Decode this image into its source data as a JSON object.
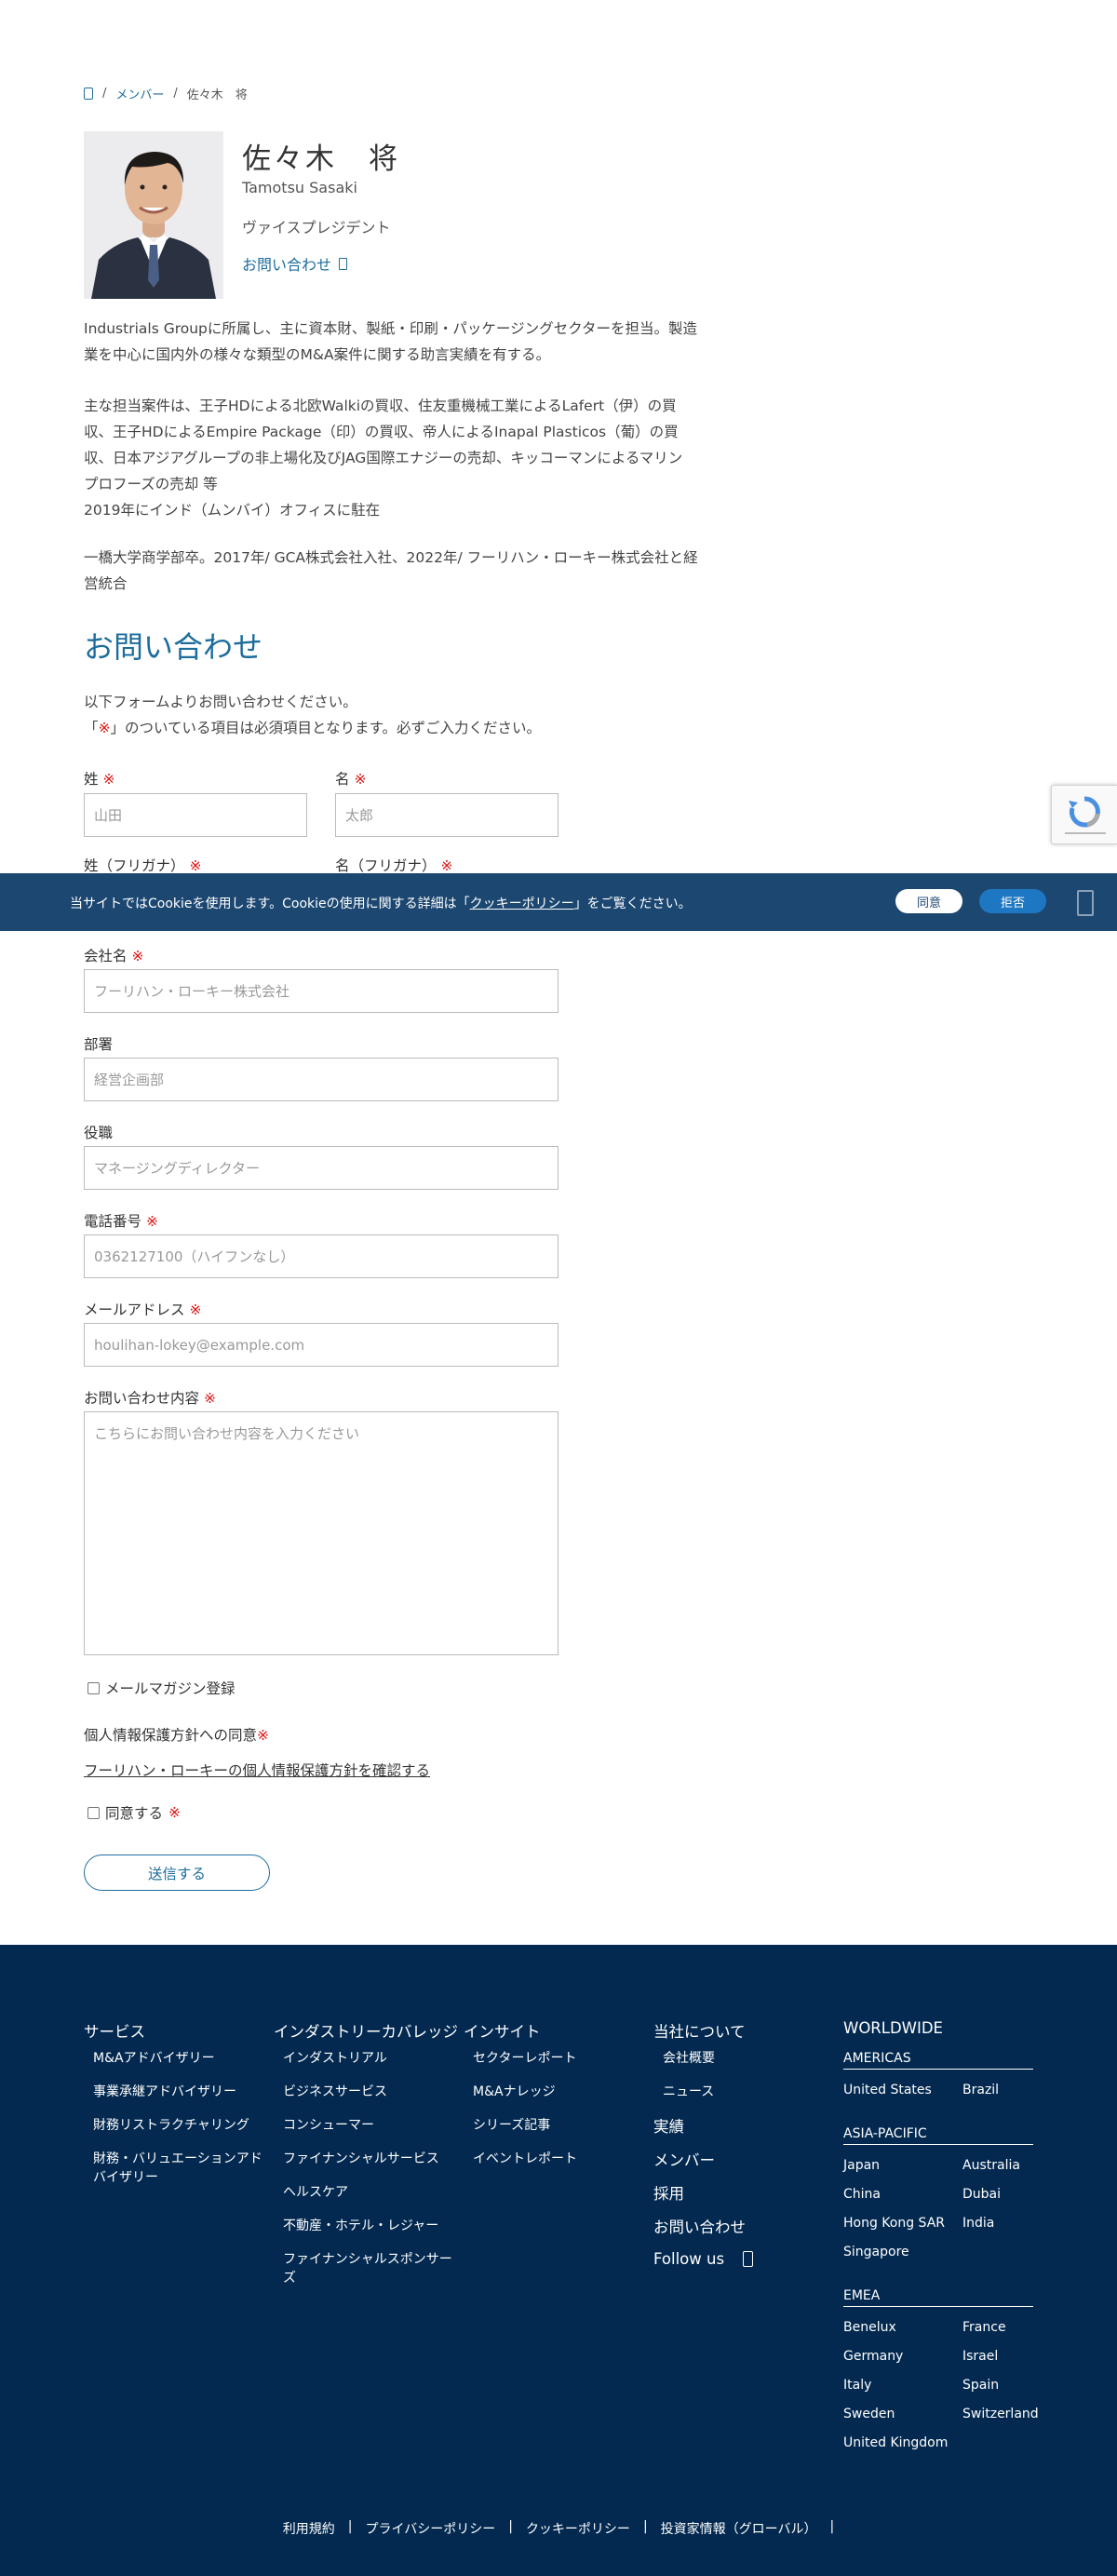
{
  "breadcrumb": {
    "members": "メンバー",
    "current": "佐々木　将"
  },
  "profile": {
    "name_jp": "佐々木　将",
    "name_en": "Tamotsu Sasaki",
    "title": "ヴァイスプレジデント",
    "contact_link": "お問い合わせ"
  },
  "bio": {
    "p1": "Industrials Groupに所属し、主に資本財、製紙・印刷・パッケージングセクターを担当。製造\n業を中心に国内外の様々な類型のM&A案件に関する助言実績を有する。",
    "p2": "主な担当案件は、王子HDによる北欧Walkiの買収、住友重機械工業によるLafert（伊）の買\n収、王子HDによるEmpire Package（印）の買収、帝人によるInapal Plasticos（葡）の買\n収、日本アジアグループの非上場化及びJAG国際エナジーの売却、キッコーマンによるマリン\nプロフーズの売却 等\n2019年にインド（ムンバイ）オフィスに駐在",
    "p3": "一橋大学商学部卒。2017年/ GCA株式会社入社、2022年/ フーリハン・ローキー株式会社と経\n営統合"
  },
  "contact": {
    "heading": "お問い合わせ",
    "intro_line1": "以下フォームよりお問い合わせください。",
    "intro_line2_a": "「",
    "intro_mark": "※",
    "intro_line2_b": "」のついている項目は必須項目となります。必ずご入力ください。",
    "req_mark": "※",
    "last_name_label": "姓",
    "last_name_ph": "山田",
    "first_name_label": "名",
    "first_name_ph": "太郎",
    "last_kana_label": "姓（フリガナ）",
    "first_kana_label": "名（フリガナ）",
    "company_label": "会社名",
    "company_ph": "フーリハン・ローキー株式会社",
    "dept_label": "部署",
    "dept_ph": "経営企画部",
    "position_label": "役職",
    "position_ph": "マネージングディレクター",
    "phone_label": "電話番号",
    "phone_ph": "0362127100（ハイフンなし）",
    "email_label": "メールアドレス",
    "email_ph": "houlihan-lokey@example.com",
    "inquiry_label": "お問い合わせ内容",
    "inquiry_ph": "こちらにお問い合わせ内容を入力ください",
    "newsletter": "メールマガジン登録",
    "privacy_label": "個人情報保護方針への同意",
    "privacy_link": "フーリハン・ローキーの個人情報保護方針を確認する",
    "agree_label": "同意する",
    "submit": "送信する"
  },
  "cookie": {
    "text_a": "当サイトではCookieを使用します。Cookieの使用に関する詳細は「",
    "policy": "クッキーポリシー",
    "text_b": "」をご覧ください。",
    "agree": "同意",
    "refuse": "拒否"
  },
  "footer": {
    "services": {
      "heading": "サービス",
      "items": [
        "M&Aアドバイザリー",
        "事業承継アドバイザリー",
        "財務リストラクチャリング",
        "財務・バリュエーションアド",
        "バイザリー"
      ]
    },
    "industry": {
      "heading": "インダストリーカバレッジ",
      "items": [
        "インダストリアル",
        "ビジネスサービス",
        "コンシューマー",
        "ファイナンシャルサービス",
        "ヘルスケア",
        "不動産・ホテル・レジャー",
        "ファイナンシャルスポンサー",
        "ズ"
      ]
    },
    "insight": {
      "heading": "インサイト",
      "items": [
        "セクターレポート",
        "M&Aナレッジ",
        "シリーズ記事",
        "イベントレポート"
      ]
    },
    "about": {
      "heading": "当社について",
      "items": [
        "会社概要",
        "ニュース"
      ],
      "links": [
        "実績",
        "メンバー",
        "採用",
        "お問い合わせ"
      ],
      "follow": "Follow us"
    },
    "worldwide": {
      "heading": "WORLDWIDE",
      "americas": "AMERICAS",
      "americas_items": [
        "United States",
        "Brazil"
      ],
      "apac": "ASIA-PACIFIC",
      "apac_items": [
        "Japan",
        "Australia",
        "China",
        "Dubai",
        "Hong Kong SAR",
        "India",
        "Singapore"
      ],
      "emea": "EMEA",
      "emea_items": [
        "Benelux",
        "France",
        "Germany",
        "Israel",
        "Italy",
        "Spain",
        "Sweden",
        "Switzerland",
        "United Kingdom"
      ]
    },
    "bottom": [
      "利用規約",
      "プライバシーポリシー",
      "クッキーポリシー",
      "投資家情報（グローバル）"
    ],
    "sep": "|"
  }
}
